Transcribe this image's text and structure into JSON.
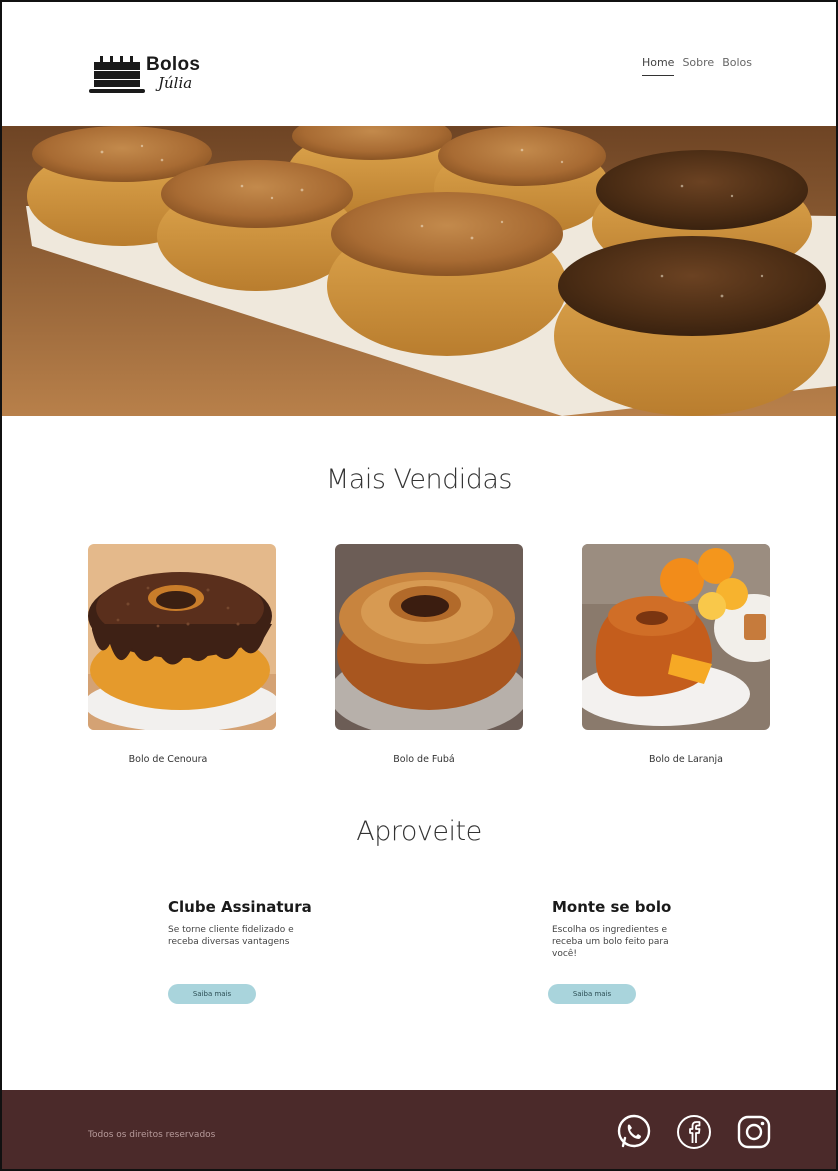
{
  "header": {
    "logo_title": "Bolos",
    "logo_subtitle": "Júlia",
    "nav": [
      {
        "label": "Home",
        "active": true
      },
      {
        "label": "Sobre",
        "active": false
      },
      {
        "label": "Bolos",
        "active": false
      }
    ]
  },
  "hero": {
    "image": "cupcakes-on-tray-photo"
  },
  "best_sellers": {
    "title": "Mais Vendidas",
    "items": [
      {
        "label": "Bolo de  Cenoura",
        "image": "carrot-cake-chocolate-photo"
      },
      {
        "label": "Bolo de  Fubá",
        "image": "cornmeal-cake-photo"
      },
      {
        "label": "Bolo de Laranja",
        "image": "orange-cake-photo"
      }
    ]
  },
  "promo": {
    "title": "Aproveite",
    "blocks": [
      {
        "heading": "Clube Assinatura",
        "text": "Se torne cliente fidelizado e receba diversas vantagens",
        "button": "Saiba mais"
      },
      {
        "heading": "Monte se bolo",
        "text": "Escolha os ingredientes e receba um bolo feito para você!",
        "button": "Saiba mais"
      }
    ]
  },
  "footer": {
    "copyright": "Todos os direitos reservados",
    "social": [
      "whatsapp-icon",
      "facebook-icon",
      "instagram-icon"
    ]
  },
  "colors": {
    "footer_bg": "#4b2a2a",
    "button_bg": "#a9d4dc"
  }
}
